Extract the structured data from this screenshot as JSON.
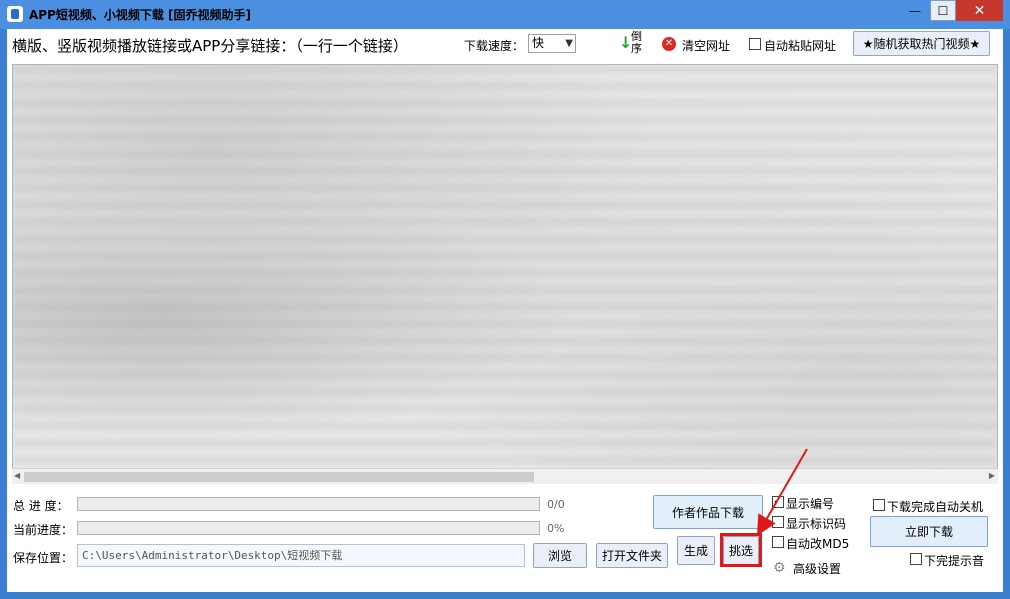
{
  "window": {
    "title": "APP短视频、小视频下载 [固乔视频助手]",
    "min_label": "—",
    "max_label": "☐",
    "close_label": "✕"
  },
  "toolbar": {
    "links_label": "横版、竖版视频播放链接或APP分享链接：（一行一个链接）",
    "speed_label": "下载速度：",
    "speed_value": "快",
    "sort_label": "倒序",
    "clear_label": "清空网址",
    "auto_paste_label": "自动粘贴网址",
    "random_hot_label": "★随机获取热门视频★"
  },
  "progress": {
    "total_label": "总 进 度：",
    "total_value": "0/0",
    "total_fraction": 0,
    "current_label": "当前进度：",
    "current_value": "0%",
    "current_fraction": 0
  },
  "save": {
    "label": "保存位置：",
    "path": "C:\\Users\\Administrator\\Desktop\\短视频下载",
    "browse_label": "浏览",
    "open_folder_label": "打开文件夹"
  },
  "actions": {
    "author_download_label": "作者作品下载",
    "generate_label": "生成",
    "select_label": "挑选",
    "show_number_label": "显示编号",
    "show_mark_label": "显示标识码",
    "auto_md5_label": "自动改MD5",
    "advanced_label": "高级设置",
    "shutdown_label": "下载完成自动关机",
    "download_now_label": "立即下载",
    "sound_label": "下完提示音"
  },
  "colors": {
    "titlebar": "#4a8fe0",
    "close_button": "#c7372b",
    "highlight": "#e01818"
  }
}
